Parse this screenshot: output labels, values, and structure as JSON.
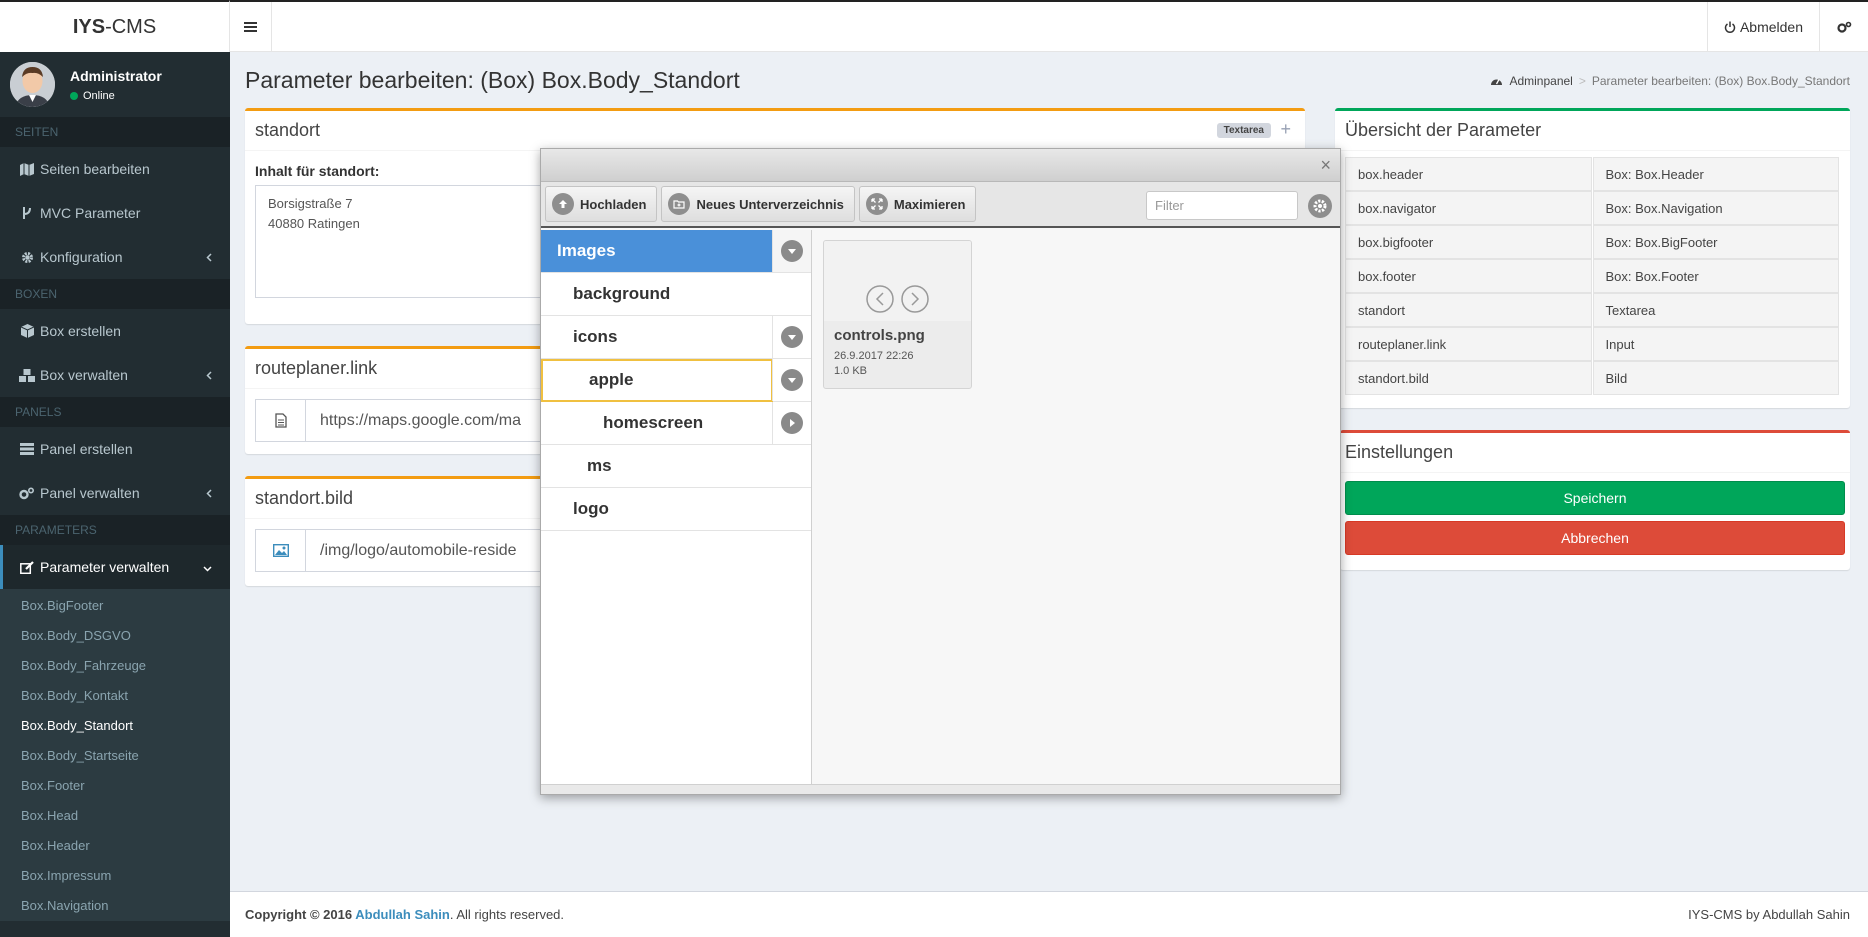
{
  "app": {
    "title_bold": "IYS",
    "title_rest": "-CMS"
  },
  "header": {
    "logout_label": "Abmelden"
  },
  "user": {
    "name": "Administrator",
    "status": "Online"
  },
  "sidebar": {
    "sections": [
      {
        "title": "SEITEN",
        "items": [
          {
            "label": "Seiten bearbeiten",
            "icon": "map-icon"
          },
          {
            "label": "MVC Parameter",
            "icon": "branch-icon"
          },
          {
            "label": "Konfiguration",
            "icon": "gear-icon"
          }
        ]
      },
      {
        "title": "BOXEN",
        "items": [
          {
            "label": "Box erstellen",
            "icon": "cube-icon"
          },
          {
            "label": "Box verwalten",
            "icon": "cubes-icon"
          }
        ]
      },
      {
        "title": "PANELS",
        "items": [
          {
            "label": "Panel erstellen",
            "icon": "list-icon"
          },
          {
            "label": "Panel verwalten",
            "icon": "cogs-icon"
          }
        ]
      },
      {
        "title": "PARAMETERS",
        "items": [
          {
            "label": "Parameter verwalten",
            "icon": "edit-icon"
          }
        ]
      }
    ],
    "submenu": [
      "Box.BigFooter",
      "Box.Body_DSGVO",
      "Box.Body_Fahrzeuge",
      "Box.Body_Kontakt",
      "Box.Body_Standort",
      "Box.Body_Startseite",
      "Box.Footer",
      "Box.Head",
      "Box.Header",
      "Box.Impressum",
      "Box.Navigation"
    ],
    "current_submenu": "Box.Body_Standort"
  },
  "page": {
    "title": "Parameter bearbeiten: (Box) Box.Body_Standort",
    "breadcrumb": {
      "home": "Adminpanel",
      "current": "Parameter bearbeiten: (Box) Box.Body_Standort"
    }
  },
  "boxes": {
    "standort": {
      "title": "standort",
      "badge": "Textarea",
      "plus": "+",
      "label": "Inhalt für standort:",
      "line1": "Borsigstraße 7",
      "line2": "40880 Ratingen"
    },
    "routeplaner": {
      "title": "routeplaner.link",
      "value": "https://maps.google.com/ma"
    },
    "bild": {
      "title": "standort.bild",
      "value": "/img/logo/automobile-reside"
    }
  },
  "overview": {
    "title": "Übersicht der Parameter",
    "rows": [
      [
        "box.header",
        "Box: Box.Header"
      ],
      [
        "box.navigator",
        "Box: Box.Navigation"
      ],
      [
        "box.bigfooter",
        "Box: Box.BigFooter"
      ],
      [
        "box.footer",
        "Box: Box.Footer"
      ],
      [
        "standort",
        "Textarea"
      ],
      [
        "routeplaner.link",
        "Input"
      ],
      [
        "standort.bild",
        "Bild"
      ]
    ]
  },
  "settings": {
    "title": "Einstellungen",
    "save": "Speichern",
    "cancel": "Abbrechen"
  },
  "filemanager": {
    "close": "×",
    "toolbar": {
      "upload": "Hochladen",
      "new_dir": "Neues Unterverzeichnis",
      "maximize": "Maximieren"
    },
    "filter_placeholder": "Filter",
    "tree": [
      {
        "label": "Images",
        "expander": "down"
      },
      {
        "label": "background",
        "expander": ""
      },
      {
        "label": "icons",
        "expander": "down"
      },
      {
        "label": "apple",
        "expander": "down"
      },
      {
        "label": "homescreen",
        "expander": "right"
      },
      {
        "label": "ms",
        "expander": ""
      },
      {
        "label": "logo",
        "expander": ""
      }
    ],
    "file": {
      "name": "controls.png",
      "date": "26.9.2017 22:26",
      "size": "1.0 KB"
    }
  },
  "footer": {
    "copyright": "Copyright © 2016 ",
    "author": "Abdullah Sahin",
    "rights": ". All rights reserved.",
    "right_text": "IYS-CMS by Abdullah Sahin"
  }
}
